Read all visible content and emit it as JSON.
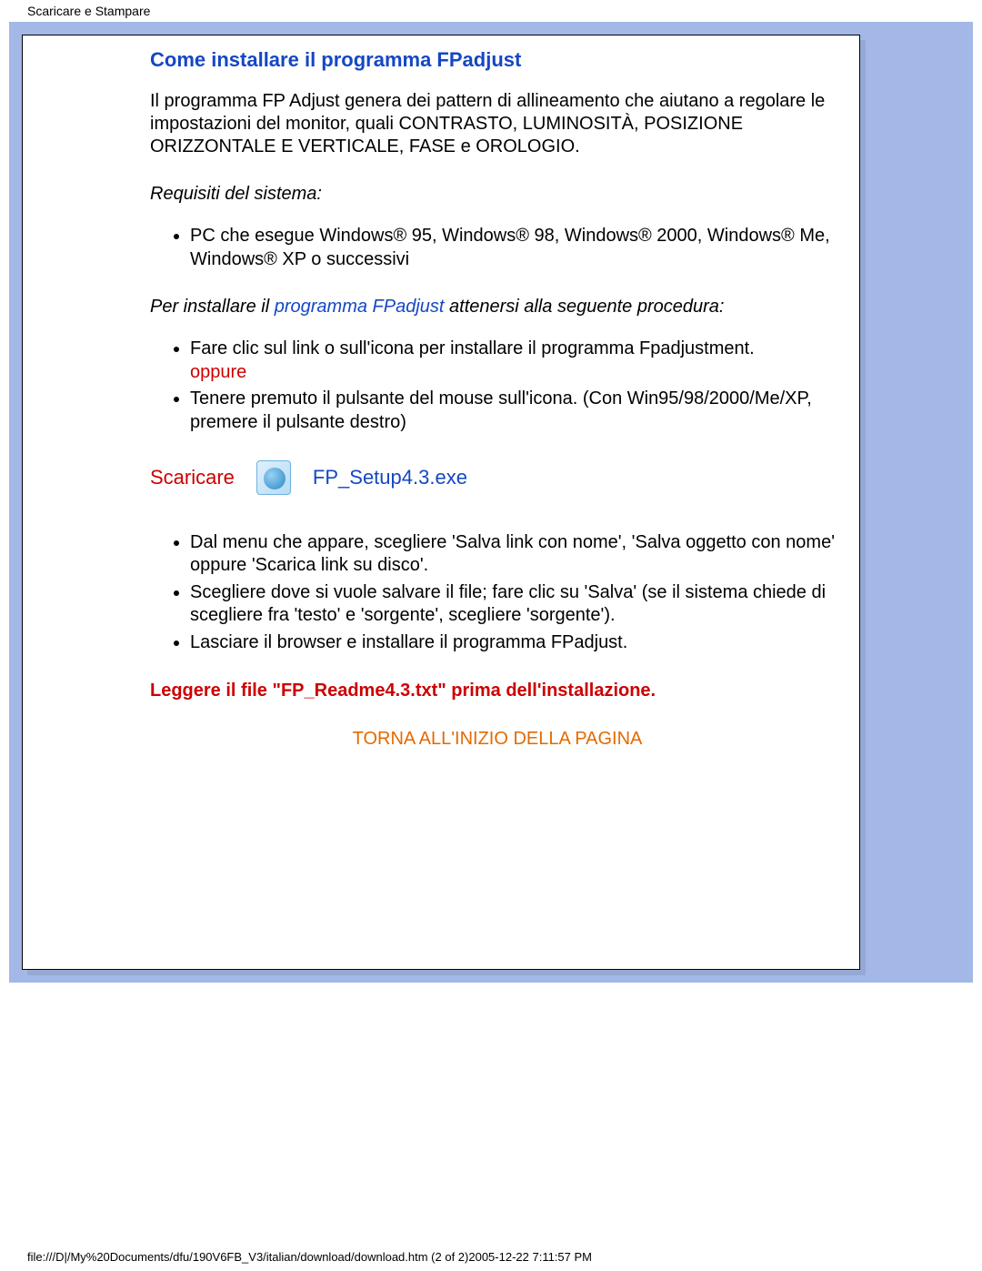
{
  "header": {
    "title": "Scaricare e Stampare"
  },
  "section": {
    "heading": "Come installare il programma FPadjust",
    "intro": "Il programma FP Adjust genera dei pattern di allineamento che aiutano a regolare le impostazioni del monitor, quali CONTRASTO, LUMINOSITÀ, POSIZIONE ORIZZONTALE E VERTICALE, FASE e OROLOGIO.",
    "requirements_title": "Requisiti del sistema:",
    "requirements": [
      "PC che esegue Windows® 95, Windows® 98, Windows® 2000, Windows® Me, Windows® XP o successivi"
    ],
    "install_line_pre": "Per installare il ",
    "install_line_link": "programma FPadjust",
    "install_line_post": " attenersi alla seguente procedura:",
    "steps_a": {
      "item1_text": "Fare clic sul link o sull'icona per installare il programma Fpadjustment.",
      "item1_or": "oppure",
      "item2_text": "Tenere premuto il pulsante del mouse sull'icona. (Con Win95/98/2000/Me/XP, premere il pulsante destro)"
    },
    "download": {
      "label": "Scaricare",
      "file": "FP_Setup4.3.exe"
    },
    "steps_b": [
      "Dal menu che appare, scegliere 'Salva link con nome', 'Salva oggetto con nome' oppure 'Scarica link su disco'.",
      "Scegliere dove si vuole salvare il file; fare clic su 'Salva' (se il sistema chiede di scegliere fra 'testo' e 'sorgente', scegliere 'sorgente').",
      "Lasciare il browser e installare il programma FPadjust."
    ],
    "readme_note": "Leggere il file \"FP_Readme4.3.txt\" prima dell'installazione.",
    "back_top": "TORNA ALL'INIZIO DELLA PAGINA"
  },
  "footer": {
    "path": "file:///D|/My%20Documents/dfu/190V6FB_V3/italian/download/download.htm (2 of 2)2005-12-22 7:11:57 PM"
  }
}
